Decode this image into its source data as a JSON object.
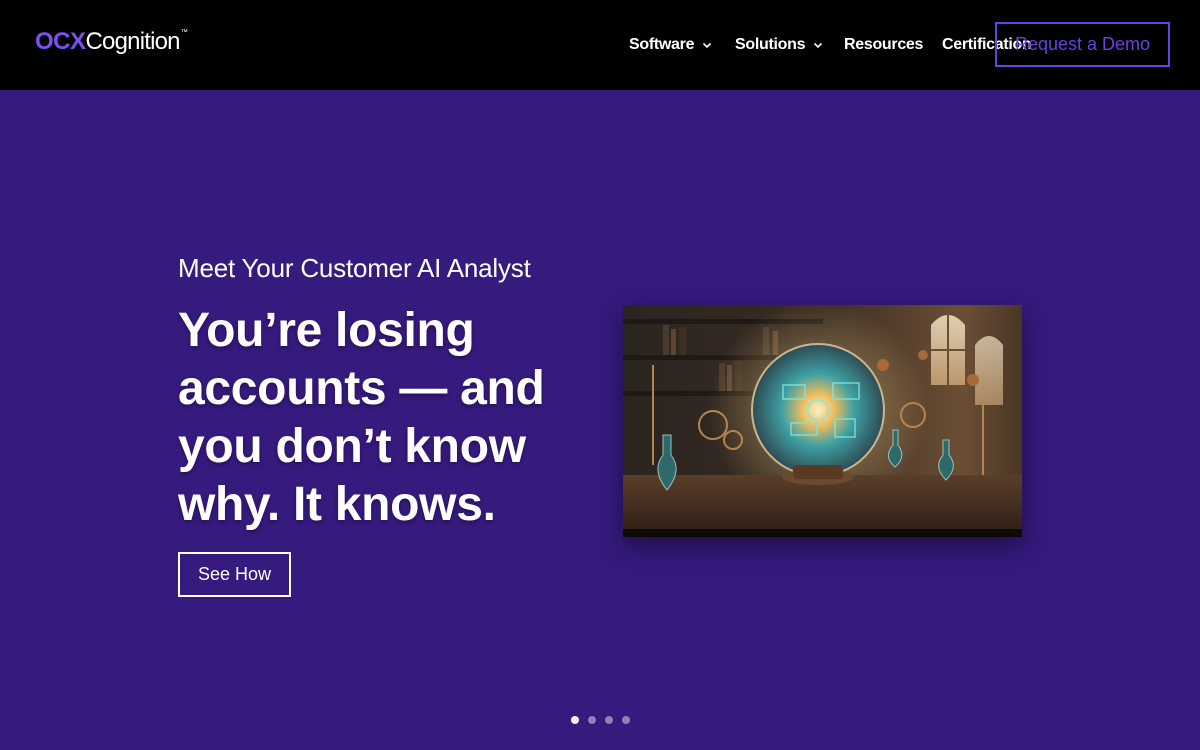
{
  "header": {
    "logo": {
      "brand": "OCX",
      "name": "Cognition",
      "trademark": "™"
    },
    "nav": [
      {
        "label": "Software",
        "has_dropdown": true,
        "icon": "chevron-down-icon"
      },
      {
        "label": "Solutions",
        "has_dropdown": true,
        "icon": "chevron-down-icon"
      },
      {
        "label": "Resources",
        "has_dropdown": false
      },
      {
        "label": "Certification",
        "has_dropdown": false
      }
    ],
    "cta_label": "Request a Demo"
  },
  "hero": {
    "eyebrow": "Meet Your Customer AI Analyst",
    "headline": "You’re losing accounts — and you don’t know why. It knows.",
    "button_label": "See How",
    "image_description_icon": "crystal-ball-lab-image"
  },
  "slider": {
    "slide_count": 4,
    "active_index": 0
  },
  "colors": {
    "header_bg": "#000000",
    "hero_bg": "#361a7e",
    "accent": "#6a3fe4",
    "logo_brand": "#7b4ff0",
    "text": "#ffffff"
  }
}
